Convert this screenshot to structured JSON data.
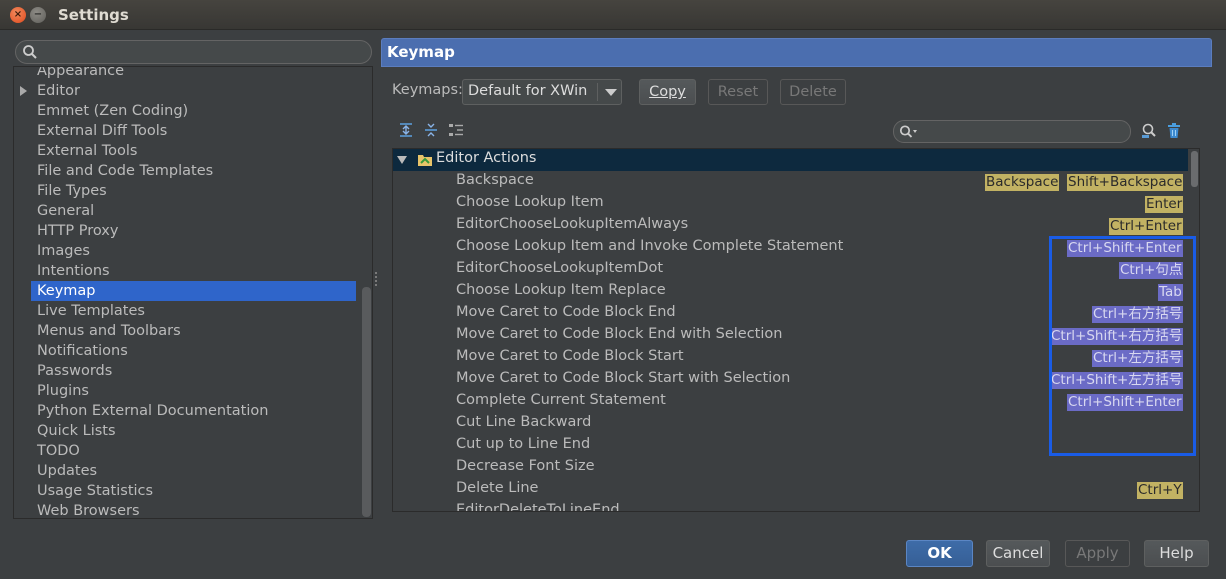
{
  "window": {
    "title": "Settings",
    "close_glyph": "×",
    "minimize_glyph": "−"
  },
  "search": {
    "placeholder": "",
    "value": ""
  },
  "tree": {
    "items": [
      {
        "label": "Appearance"
      },
      {
        "label": "Editor",
        "expandable": true
      },
      {
        "label": "Emmet (Zen Coding)"
      },
      {
        "label": "External Diff Tools"
      },
      {
        "label": "External Tools"
      },
      {
        "label": "File and Code Templates"
      },
      {
        "label": "File Types"
      },
      {
        "label": "General"
      },
      {
        "label": "HTTP Proxy"
      },
      {
        "label": "Images"
      },
      {
        "label": "Intentions"
      },
      {
        "label": "Keymap",
        "selected": true
      },
      {
        "label": "Live Templates"
      },
      {
        "label": "Menus and Toolbars"
      },
      {
        "label": "Notifications"
      },
      {
        "label": "Passwords"
      },
      {
        "label": "Plugins"
      },
      {
        "label": "Python External Documentation"
      },
      {
        "label": "Quick Lists"
      },
      {
        "label": "TODO"
      },
      {
        "label": "Updates"
      },
      {
        "label": "Usage Statistics"
      },
      {
        "label": "Web Browsers"
      }
    ]
  },
  "header": {
    "title": "Keymap"
  },
  "keymaps": {
    "label": "Keymaps:",
    "selected": "Default for XWin",
    "copy_label": "Copy",
    "reset_label": "Reset",
    "delete_label": "Delete"
  },
  "toolbar": {
    "icons": [
      "expand-all-icon",
      "collapse-all-icon",
      "show-tree-icon"
    ],
    "filter_placeholder": "",
    "find_shortcut_icon": "find-by-shortcut-icon",
    "clear_icon": "trash-icon"
  },
  "actions": {
    "group": "Editor Actions",
    "rows": [
      {
        "name": "Backspace",
        "shortcuts": [
          {
            "text": "Backspace",
            "style": "yellow"
          },
          {
            "text": "Shift+Backspace",
            "style": "yellow"
          }
        ]
      },
      {
        "name": "Choose Lookup Item",
        "shortcuts": [
          {
            "text": "Enter",
            "style": "yellow"
          }
        ]
      },
      {
        "name": "EditorChooseLookupItemAlways",
        "shortcuts": [
          {
            "text": "Ctrl+Enter",
            "style": "yellow"
          }
        ]
      },
      {
        "name": "Choose Lookup Item and Invoke Complete Statement",
        "shortcuts": [
          {
            "text": "Ctrl+Shift+Enter",
            "style": "purple"
          }
        ]
      },
      {
        "name": "EditorChooseLookupItemDot",
        "shortcuts": [
          {
            "text": "Ctrl+句点",
            "style": "purple"
          }
        ]
      },
      {
        "name": "Choose Lookup Item Replace",
        "shortcuts": [
          {
            "text": "Tab",
            "style": "purple"
          }
        ]
      },
      {
        "name": "Move Caret to Code Block End",
        "shortcuts": [
          {
            "text": "Ctrl+右方括号",
            "style": "purple"
          }
        ]
      },
      {
        "name": "Move Caret to Code Block End with Selection",
        "shortcuts": [
          {
            "text": "Ctrl+Shift+右方括号",
            "style": "purple"
          }
        ]
      },
      {
        "name": "Move Caret to Code Block Start",
        "shortcuts": [
          {
            "text": "Ctrl+左方括号",
            "style": "purple"
          }
        ]
      },
      {
        "name": "Move Caret to Code Block Start with Selection",
        "shortcuts": [
          {
            "text": "Ctrl+Shift+左方括号",
            "style": "purple"
          }
        ]
      },
      {
        "name": "Complete Current Statement",
        "shortcuts": [
          {
            "text": "Ctrl+Shift+Enter",
            "style": "purple"
          }
        ]
      },
      {
        "name": "Cut Line Backward",
        "shortcuts": []
      },
      {
        "name": "Cut up to Line End",
        "shortcuts": []
      },
      {
        "name": "Decrease Font Size",
        "shortcuts": []
      },
      {
        "name": "Delete Line",
        "shortcuts": [
          {
            "text": "Ctrl+Y",
            "style": "yellow"
          }
        ]
      },
      {
        "name": "EditorDeleteToLineEnd",
        "shortcuts": []
      }
    ]
  },
  "footer": {
    "ok_label": "OK",
    "cancel_label": "Cancel",
    "apply_label": "Apply",
    "help_label": "Help"
  },
  "colors": {
    "accent": "#4b6eaf",
    "selection": "#2f65ca",
    "shortcut_yellow": "#c2b263",
    "shortcut_purple": "#6b6bc6",
    "highlight_border": "#1a5ce6"
  }
}
